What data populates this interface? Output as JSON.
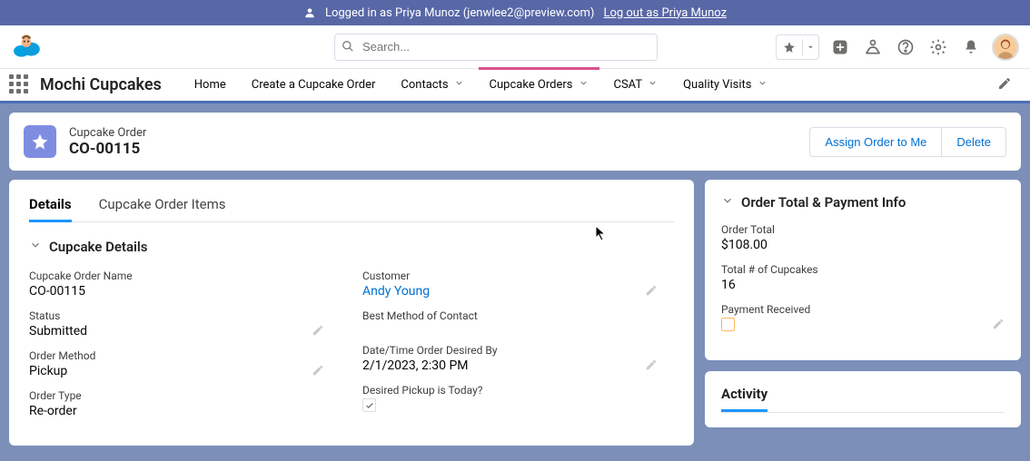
{
  "banner": {
    "prefix": "Logged in as Priya Munoz (jenwlee2@preview.com)",
    "logout": "Log out as Priya Munoz"
  },
  "header": {
    "search_placeholder": "Search..."
  },
  "nav": {
    "app_name": "Mochi Cupcakes",
    "items": [
      {
        "label": "Home",
        "dropdown": false,
        "active": false
      },
      {
        "label": "Create a Cupcake Order",
        "dropdown": false,
        "active": false
      },
      {
        "label": "Contacts",
        "dropdown": true,
        "active": false
      },
      {
        "label": "Cupcake Orders",
        "dropdown": true,
        "active": true
      },
      {
        "label": "CSAT",
        "dropdown": true,
        "active": false
      },
      {
        "label": "Quality Visits",
        "dropdown": true,
        "active": false
      }
    ]
  },
  "record": {
    "type": "Cupcake Order",
    "name": "CO-00115",
    "actions": {
      "assign": "Assign Order to Me",
      "delete": "Delete"
    }
  },
  "tabs": {
    "details": "Details",
    "items": "Cupcake Order Items"
  },
  "section": {
    "details_title": "Cupcake Details"
  },
  "fields": {
    "left": {
      "name_label": "Cupcake Order Name",
      "name_value": "CO-00115",
      "status_label": "Status",
      "status_value": "Submitted",
      "method_label": "Order Method",
      "method_value": "Pickup",
      "type_label": "Order Type",
      "type_value": "Re-order"
    },
    "right": {
      "customer_label": "Customer",
      "customer_value": "Andy Young",
      "contact_label": "Best Method of Contact",
      "contact_value": "",
      "desired_label": "Date/Time Order Desired By",
      "desired_value": "2/1/2023, 2:30 PM",
      "pickup_today_label": "Desired Pickup is Today?",
      "pickup_today_checked": true
    }
  },
  "side": {
    "payment_title": "Order Total & Payment Info",
    "order_total_label": "Order Total",
    "order_total_value": "$108.00",
    "count_label": "Total # of Cupcakes",
    "count_value": "16",
    "payment_received_label": "Payment Received",
    "payment_received_checked": false,
    "activity_title": "Activity"
  }
}
